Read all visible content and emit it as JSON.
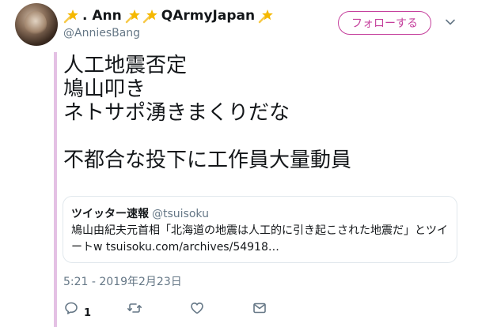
{
  "user": {
    "name_part1": ". Ann",
    "name_part2": "QArmyJapan",
    "handle": "@AnniesBang"
  },
  "follow_button": {
    "label": "フォローする"
  },
  "tweet": {
    "text": "人工地震否定\n鳩山叩き\nネトサポ湧きまくりだな\n\n不都合な投下に工作員大量動員"
  },
  "quote": {
    "name": "ツイッター速報",
    "handle": "@tsuisoku",
    "body": "鳩山由紀夫元首相「北海道の地震は人工的に引き起こされた地震だ」とツイートw tsuisoku.com/archives/54918…"
  },
  "timestamp": "5:21 - 2019年2月23日",
  "actions": {
    "reply_count": "1"
  },
  "colors": {
    "accent": "#c53f9c",
    "thread_line": "#e4c1e4",
    "muted": "#657786",
    "star": "#f5b800"
  }
}
